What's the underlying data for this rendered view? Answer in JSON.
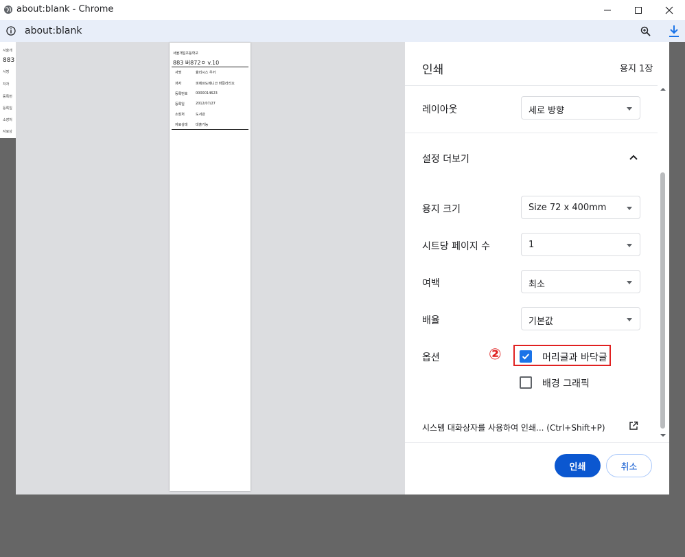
{
  "window": {
    "title": "about:blank - Chrome"
  },
  "address": {
    "url": "about:blank"
  },
  "background_page": {
    "lines": [
      "서울개",
      "883",
      "서명",
      "저자",
      "등록번",
      "등록일",
      "소장처",
      "자료상"
    ]
  },
  "preview": {
    "school": "서울개일초등학교",
    "call_number": "883 버872ㅇ v.10",
    "rows": [
      {
        "k": "서명",
        "v": "율리시스 우어"
      },
      {
        "k": "저자",
        "v": "피에르도메니코 바칼라리오"
      },
      {
        "k": "등록번호",
        "v": "0000014623"
      },
      {
        "k": "등록일",
        "v": "2012/07/27"
      },
      {
        "k": "소장처",
        "v": "도서관"
      },
      {
        "k": "자료상태",
        "v": "대출가능"
      }
    ]
  },
  "panel": {
    "title": "인쇄",
    "pages": "용지 1장",
    "layout_label": "레이아웃",
    "layout_value": "세로 방향",
    "more_settings": "설정 더보기",
    "paper_size_label": "용지 크기",
    "paper_size_value": "Size 72 x 400mm",
    "pages_per_sheet_label": "시트당 페이지 수",
    "pages_per_sheet_value": "1",
    "margins_label": "여백",
    "margins_value": "최소",
    "scale_label": "배율",
    "scale_value": "기본값",
    "options_label": "옵션",
    "annotation_number": "②",
    "header_footer_label": "머리글과 바닥글",
    "header_footer_checked": true,
    "background_graphics_label": "배경 그래픽",
    "background_graphics_checked": false,
    "system_dialog_label": "시스템 대화상자를 사용하여 인쇄... (Ctrl+Shift+P)",
    "print_button": "인쇄",
    "cancel_button": "취소"
  },
  "colors": {
    "accent": "#0b57d0",
    "annotation": "#e02020"
  }
}
